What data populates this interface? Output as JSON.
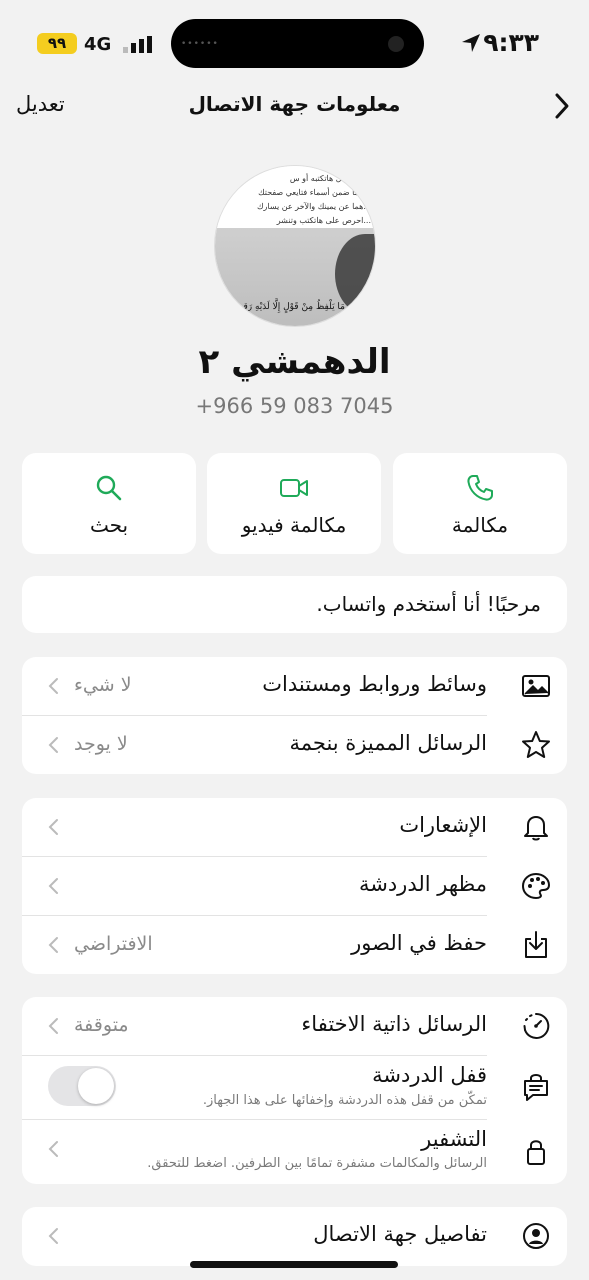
{
  "status_bar": {
    "time": "٩:٣٣",
    "battery": "٩٩",
    "network": "4G"
  },
  "nav": {
    "title": "معلومات جهة الاتصال",
    "edit_label": "تعديل"
  },
  "contact": {
    "name": "الدهمشي ٢",
    "phone": "+966 59 083 7045",
    "avatar_text_lines": [
      "...يابان كلّ هاتكتبه أو س",
      "...هما ضمن أسماء فتايعي صفحتك",
      "...هما عن يمينك والآخر عن يسارك",
      "...احرص على هاتكتب وتنشر"
    ],
    "avatar_caption": "مَا يَلْفِظُ مِنْ قَوْلٍ إِلَّا لَدَيْهِ رَقِيبٌ"
  },
  "actions": [
    {
      "label": "مكالمة",
      "icon": "phone-icon"
    },
    {
      "label": "مكالمة فيديو",
      "icon": "video-icon"
    },
    {
      "label": "بحث",
      "icon": "search-icon"
    }
  ],
  "about": "مرحبًا! أنا أستخدم واتساب.",
  "group1": [
    {
      "label": "وسائط وروابط ومستندات",
      "value": "لا شيء",
      "icon": "image-icon"
    },
    {
      "label": "الرسائل المميزة بنجمة",
      "value": "لا يوجد",
      "icon": "star-icon"
    }
  ],
  "group2": [
    {
      "label": "الإشعارات",
      "value": "",
      "icon": "bell-icon"
    },
    {
      "label": "مظهر الدردشة",
      "value": "",
      "icon": "palette-icon"
    },
    {
      "label": "حفظ في الصور",
      "value": "الافتراضي",
      "icon": "save-download-icon"
    }
  ],
  "group3": {
    "disappearing": {
      "label": "الرسائل ذاتية الاختفاء",
      "value": "متوقفة",
      "icon": "timer-icon"
    },
    "chat_lock": {
      "label": "قفل الدردشة",
      "sub": "تمكّن من قفل هذه الدردشة وإخفائها على هذا الجهاز.",
      "icon": "chat-lock-icon",
      "enabled": false
    },
    "encryption": {
      "label": "التشفير",
      "sub": "الرسائل والمكالمات مشفرة تمامًا بين الطرفين. اضغط للتحقق.",
      "icon": "lock-icon"
    }
  },
  "group4": [
    {
      "label": "تفاصيل جهة الاتصال",
      "icon": "contact-circle-icon"
    }
  ],
  "colors": {
    "accent_green": "#1faa59",
    "background": "#f2f2f2",
    "card": "#ffffff",
    "battery": "#f4cd1f"
  }
}
